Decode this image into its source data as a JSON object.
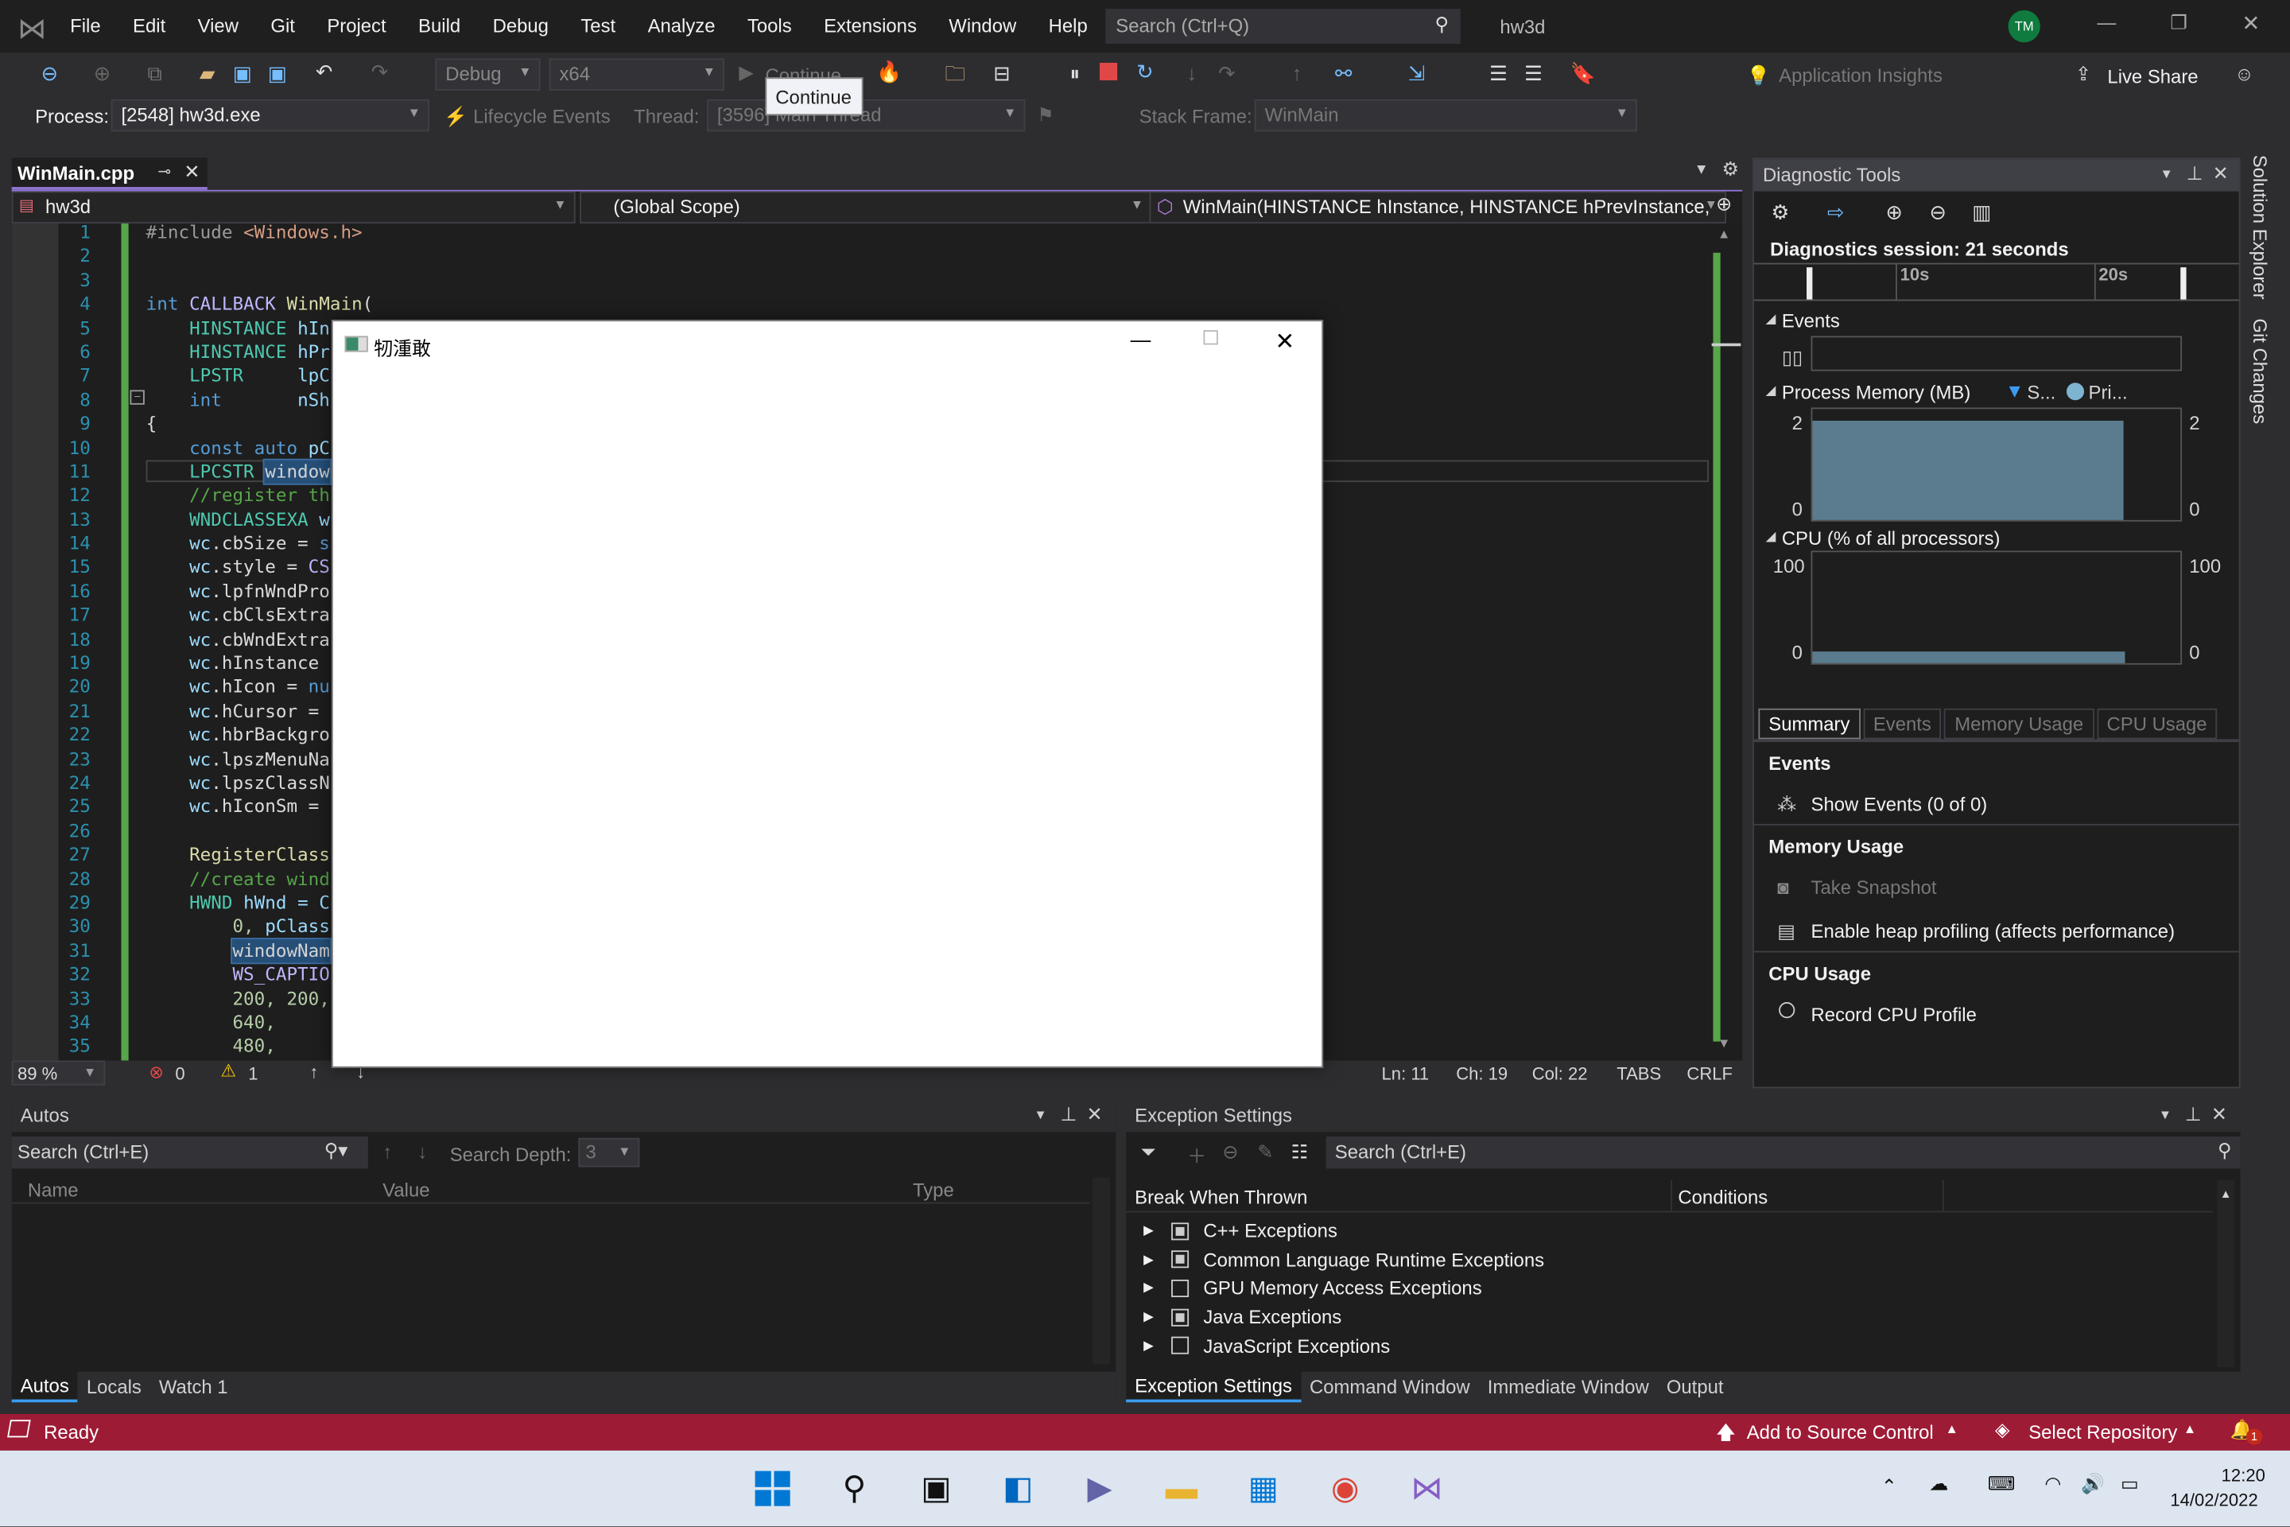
{
  "menu": [
    "File",
    "Edit",
    "View",
    "Git",
    "Project",
    "Build",
    "Debug",
    "Test",
    "Analyze",
    "Tools",
    "Extensions",
    "Window",
    "Help"
  ],
  "search": {
    "placeholder": "Search (Ctrl+Q)"
  },
  "solution_name": "hw3d",
  "user_initials": "TM",
  "toolbar": {
    "config": "Debug",
    "platform": "x64",
    "continue": "Continue",
    "tooltip": "Continue",
    "app_insights": "Application Insights",
    "live_share": "Live Share"
  },
  "debugbar": {
    "process_label": "Process:",
    "process": "[2548] hw3d.exe",
    "lifecycle": "Lifecycle Events",
    "thread_label": "Thread:",
    "thread": "[3596] Main Thread",
    "stack_label": "Stack Frame:",
    "stack": "WinMain"
  },
  "editor": {
    "tab": "WinMain.cpp",
    "project": "hw3d",
    "scope": "(Global Scope)",
    "member": "WinMain(HINSTANCE hInstance, HINSTANCE hPrevInstance,",
    "zoom": "89 %",
    "errors": "0",
    "warnings": "1",
    "ln": "Ln: 11",
    "ch": "Ch: 19",
    "col": "Col: 22",
    "tabs": "TABS",
    "eol": "CRLF",
    "lines": [
      [
        [
          "#include ",
          "p"
        ],
        [
          "<Windows.h>",
          "s"
        ]
      ],
      [],
      [],
      [
        [
          "int ",
          "k"
        ],
        [
          "CALLBACK ",
          "m"
        ],
        [
          "WinMain",
          "f"
        ],
        [
          "(",
          "x"
        ]
      ],
      [
        [
          "    HINSTANCE ",
          "t"
        ],
        [
          "hIn",
          "v"
        ]
      ],
      [
        [
          "    HINSTANCE ",
          "t"
        ],
        [
          "hPr",
          "v"
        ]
      ],
      [
        [
          "    LPSTR     ",
          "t"
        ],
        [
          "lpC",
          "v"
        ]
      ],
      [
        [
          "    int       ",
          "k"
        ],
        [
          "nSh",
          "v"
        ]
      ],
      [
        [
          "{",
          "x"
        ]
      ],
      [
        [
          "    const auto ",
          "k"
        ],
        [
          "pC",
          "v"
        ]
      ],
      [
        [
          "    LPCSTR ",
          "t"
        ],
        [
          "window",
          "h"
        ]
      ],
      [
        [
          "    //register th",
          "c"
        ]
      ],
      [
        [
          "    WNDCLASSEXA ",
          "t"
        ],
        [
          "w",
          "v"
        ]
      ],
      [
        [
          "    wc",
          "v"
        ],
        [
          ".cbSize = ",
          "x"
        ],
        [
          "s",
          "k"
        ]
      ],
      [
        [
          "    wc",
          "v"
        ],
        [
          ".style = ",
          "x"
        ],
        [
          "CS",
          "m"
        ]
      ],
      [
        [
          "    wc",
          "v"
        ],
        [
          ".lpfnWndPro",
          "x"
        ]
      ],
      [
        [
          "    wc",
          "v"
        ],
        [
          ".cbClsExtra",
          "x"
        ]
      ],
      [
        [
          "    wc",
          "v"
        ],
        [
          ".cbWndExtra",
          "x"
        ]
      ],
      [
        [
          "    wc",
          "v"
        ],
        [
          ".hInstance ",
          "x"
        ]
      ],
      [
        [
          "    wc",
          "v"
        ],
        [
          ".hIcon = ",
          "x"
        ],
        [
          "nu",
          "k"
        ]
      ],
      [
        [
          "    wc",
          "v"
        ],
        [
          ".hCursor = ",
          "x"
        ]
      ],
      [
        [
          "    wc",
          "v"
        ],
        [
          ".hbrBackgro",
          "x"
        ]
      ],
      [
        [
          "    wc",
          "v"
        ],
        [
          ".lpszMenuNa",
          "x"
        ]
      ],
      [
        [
          "    wc",
          "v"
        ],
        [
          ".lpszClassN",
          "x"
        ]
      ],
      [
        [
          "    wc",
          "v"
        ],
        [
          ".hIconSm = ",
          "x"
        ]
      ],
      [],
      [
        [
          "    RegisterClass",
          "f"
        ]
      ],
      [
        [
          "    //create wind",
          "c"
        ]
      ],
      [
        [
          "    HWND ",
          "t"
        ],
        [
          "hWnd = C",
          "v"
        ]
      ],
      [
        [
          "        0, ",
          "n"
        ],
        [
          "pClass",
          "v"
        ]
      ],
      [
        [
          "        ",
          "x"
        ],
        [
          "windowNam",
          "h"
        ]
      ],
      [
        [
          "        WS_CAPTIO",
          "m"
        ]
      ],
      [
        [
          "        200, 200,",
          "n"
        ]
      ],
      [
        [
          "        640,",
          "n"
        ]
      ],
      [
        [
          "        480,",
          "n"
        ]
      ]
    ]
  },
  "app_window": {
    "title": "牣湩敢"
  },
  "diagnostics": {
    "title": "Diagnostic Tools",
    "session": "Diagnostics session: 21 seconds",
    "ticks": [
      "10s",
      "20s"
    ],
    "events": "Events",
    "memory": "Process Memory (MB)",
    "legend_s": "S...",
    "legend_p": "Pri...",
    "mem_max": "2",
    "mem_min": "0",
    "cpu": "CPU (% of all processors)",
    "cpu_max": "100",
    "cpu_min": "0",
    "tabs": [
      "Summary",
      "Events",
      "Memory Usage",
      "CPU Usage"
    ],
    "sec_events": "Events",
    "show_events": "Show Events (0 of 0)",
    "sec_memory": "Memory Usage",
    "take_snapshot": "Take Snapshot",
    "heap": "Enable heap profiling (affects performance)",
    "sec_cpu": "CPU Usage",
    "record_cpu": "Record CPU Profile",
    "memory_mb": 2,
    "cpu_percent": 4
  },
  "side_tabs": [
    "Solution Explorer",
    "Git Changes"
  ],
  "autos": {
    "title": "Autos",
    "search": "Search (Ctrl+E)",
    "depth_label": "Search Depth:",
    "depth": "3",
    "cols": [
      "Name",
      "Value",
      "Type"
    ],
    "tabs": [
      "Autos",
      "Locals",
      "Watch 1"
    ]
  },
  "exceptions": {
    "title": "Exception Settings",
    "search": "Search (Ctrl+E)",
    "cols": [
      "Break When Thrown",
      "Conditions"
    ],
    "rows": [
      {
        "label": "C++ Exceptions",
        "checked": true
      },
      {
        "label": "Common Language Runtime Exceptions",
        "checked": true
      },
      {
        "label": "GPU Memory Access Exceptions",
        "checked": false
      },
      {
        "label": "Java Exceptions",
        "checked": true
      },
      {
        "label": "JavaScript Exceptions",
        "checked": false
      }
    ],
    "tabs": [
      "Exception Settings",
      "Command Window",
      "Immediate Window",
      "Output"
    ]
  },
  "status": {
    "ready": "Ready",
    "source_control": "Add to Source Control",
    "repo": "Select Repository",
    "notifications": "1",
    "color": "#9e1b36"
  },
  "taskbar": {
    "time": "12:20",
    "date": "14/02/2022"
  }
}
